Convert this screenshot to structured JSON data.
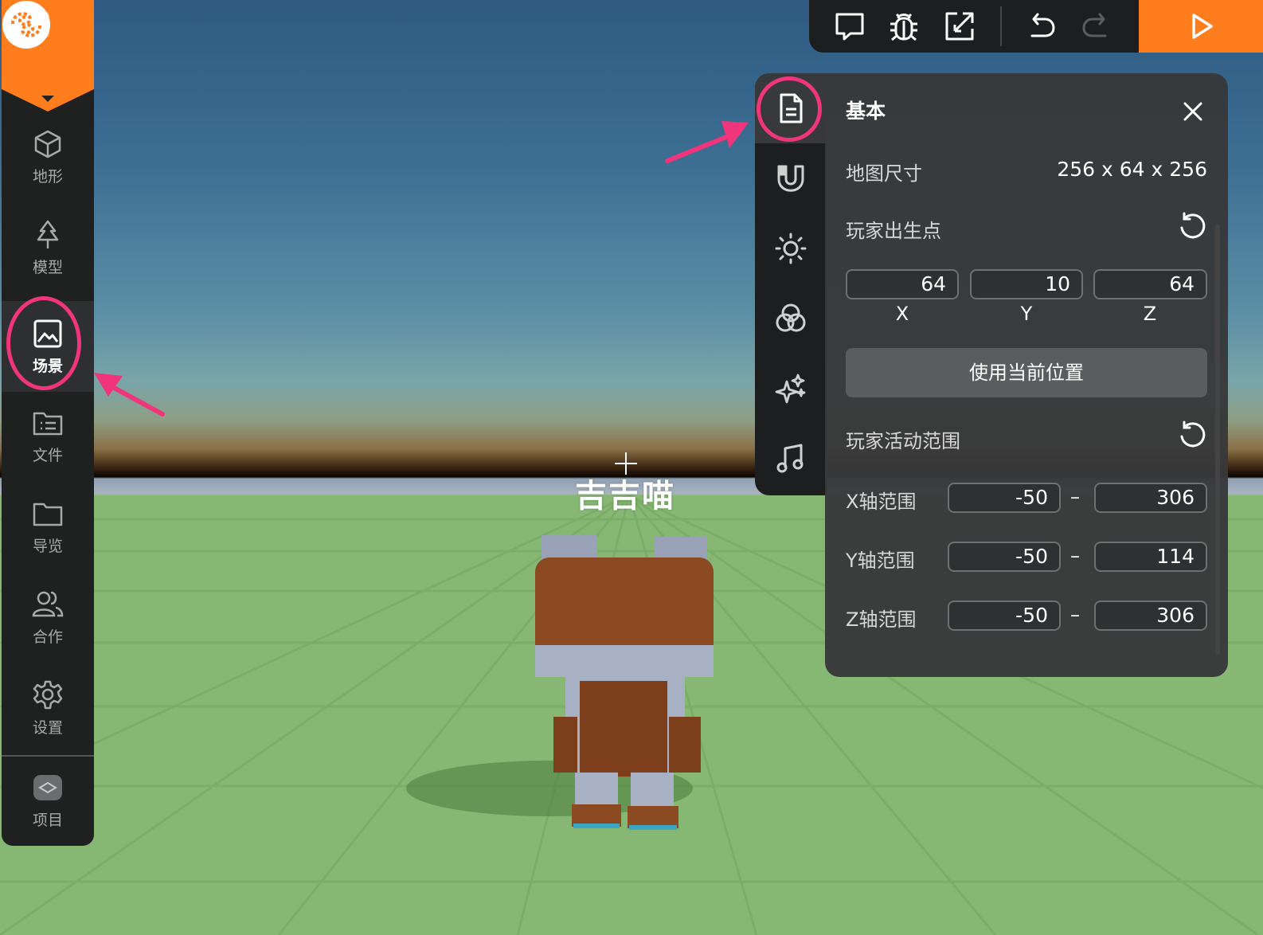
{
  "viewport": {
    "player_name": "吉吉喵"
  },
  "sidebar": {
    "terminal_badge": ">_",
    "items": [
      {
        "label": "地形",
        "icon": "cube-icon"
      },
      {
        "label": "模型",
        "icon": "tree-icon"
      },
      {
        "label": "场景",
        "icon": "image-icon",
        "active": true
      },
      {
        "label": "文件",
        "icon": "file-list-icon"
      },
      {
        "label": "导览",
        "icon": "folder-icon"
      },
      {
        "label": "合作",
        "icon": "users-icon"
      },
      {
        "label": "设置",
        "icon": "gear-icon"
      },
      {
        "label": "项目",
        "icon": "project-icon"
      }
    ]
  },
  "toolbar": {
    "buttons": [
      "comment-icon",
      "bug-icon",
      "expand-icon",
      "undo-icon",
      "redo-icon",
      "play-icon"
    ]
  },
  "panel": {
    "tabs": [
      "document-icon",
      "magnet-icon",
      "sun-icon",
      "color-circles-icon",
      "sparkle-icon",
      "music-note-icon"
    ],
    "title": "基本",
    "map_size_label": "地图尺寸",
    "map_size_value": "256 x 64 x 256",
    "spawn_label": "玩家出生点",
    "spawn": {
      "x": "64",
      "y": "10",
      "z": "64"
    },
    "axis_labels": {
      "x": "X",
      "y": "Y",
      "z": "Z"
    },
    "use_current_position": "使用当前位置",
    "range_label": "玩家活动范围",
    "ranges": [
      {
        "label": "X轴范围",
        "min": "-50",
        "max": "306"
      },
      {
        "label": "Y轴范围",
        "min": "-50",
        "max": "114"
      },
      {
        "label": "Z轴范围",
        "min": "-50",
        "max": "306"
      }
    ],
    "range_separator": "–"
  },
  "colors": {
    "accent": "#ff7d1c",
    "highlight": "#f0357a",
    "panel_bg": "#38393a",
    "sidebar_bg": "#1f2121"
  }
}
